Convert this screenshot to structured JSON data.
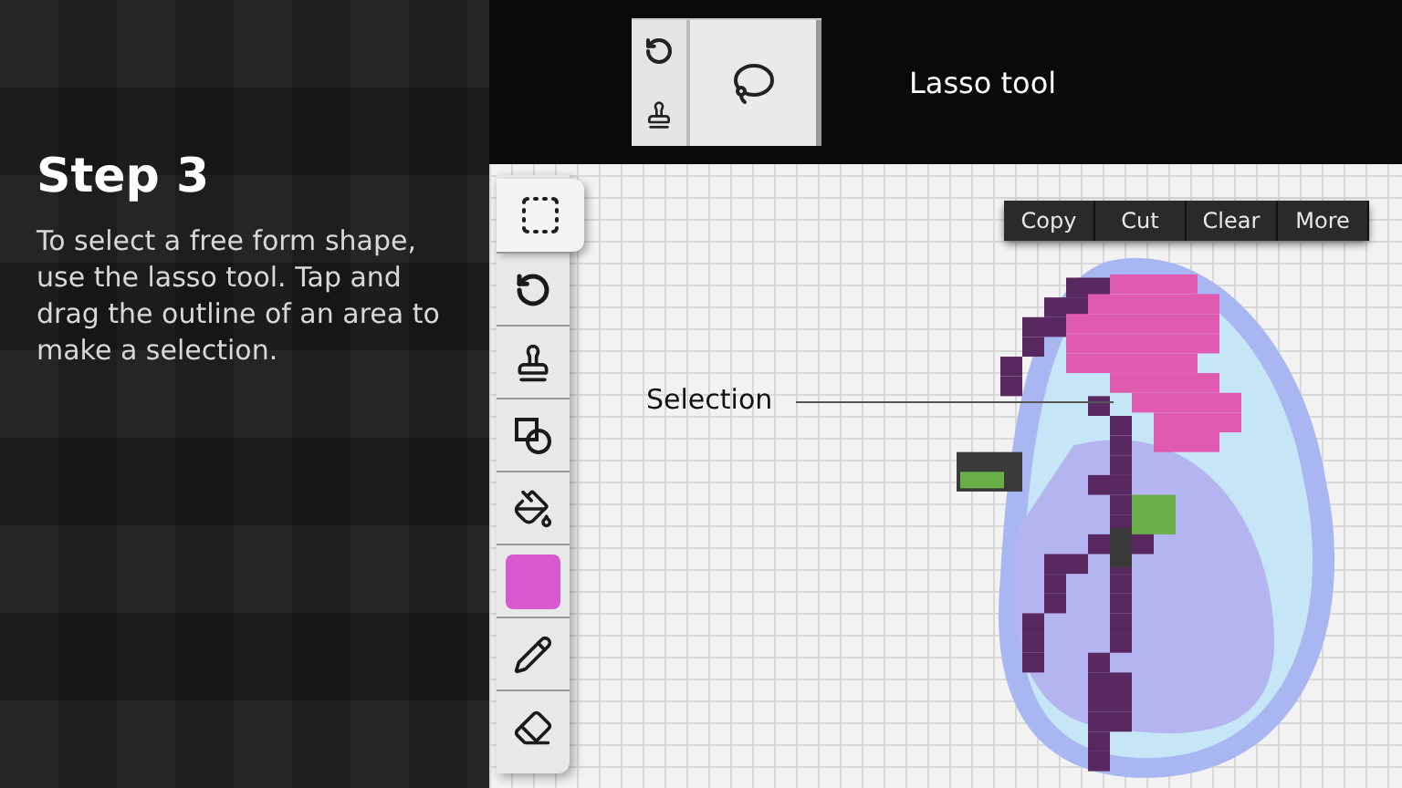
{
  "step": {
    "title": "Step 3",
    "description": "To select a free form shape, use the lasso tool. Tap and drag the outline of an area to make a selection."
  },
  "header": {
    "label": "Lasso tool"
  },
  "tools": [
    {
      "kind": "select",
      "selected": true
    },
    {
      "kind": "undo",
      "selected": false
    },
    {
      "kind": "stamp",
      "selected": false
    },
    {
      "kind": "shapes",
      "selected": false
    },
    {
      "kind": "fill",
      "selected": false
    },
    {
      "kind": "color",
      "selected": false,
      "color": "#d858d0"
    },
    {
      "kind": "pencil",
      "selected": false
    },
    {
      "kind": "eraser",
      "selected": false
    }
  ],
  "context_menu": [
    "Copy",
    "Cut",
    "Clear",
    "More"
  ],
  "callout": "Selection"
}
